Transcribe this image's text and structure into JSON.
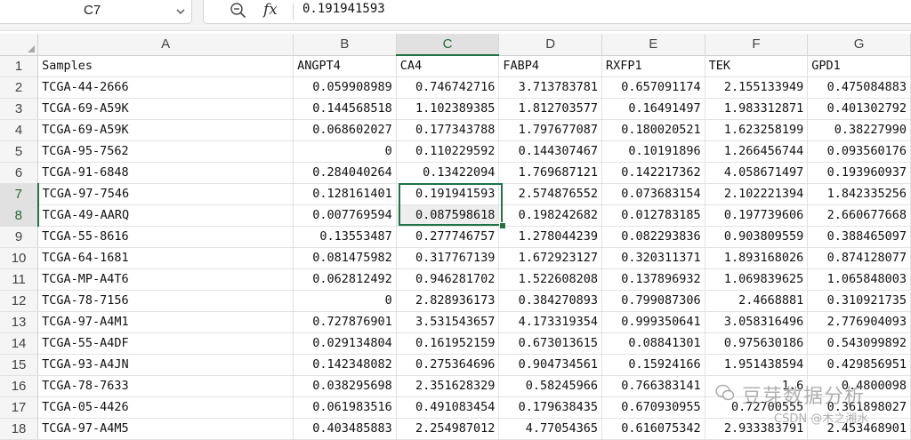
{
  "formula_bar": {
    "name_box": "C7",
    "fx_label": "fx",
    "formula_value": "0.191941593"
  },
  "columns": [
    "A",
    "B",
    "C",
    "D",
    "E",
    "F",
    "G"
  ],
  "active_column": "C",
  "active_rows": [
    7,
    8
  ],
  "rows": [
    {
      "num": "1",
      "cells": [
        "Samples",
        "ANGPT4",
        "CA4",
        "FABP4",
        "RXFP1",
        "TEK",
        "GPD1"
      ]
    },
    {
      "num": "2",
      "cells": [
        "TCGA-44-2666",
        "0.059908989",
        "0.746742716",
        "3.713783781",
        "0.657091174",
        "2.155133949",
        "0.475084883"
      ]
    },
    {
      "num": "3",
      "cells": [
        "TCGA-69-A59K",
        "0.144568518",
        "1.102389385",
        "1.812703577",
        "0.16491497",
        "1.983312871",
        "0.401302792"
      ]
    },
    {
      "num": "4",
      "cells": [
        "TCGA-69-A59K",
        "0.068602027",
        "0.177343788",
        "1.797677087",
        "0.180020521",
        "1.623258199",
        "0.38227990"
      ]
    },
    {
      "num": "5",
      "cells": [
        "TCGA-95-7562",
        "0",
        "0.110229592",
        "0.144307467",
        "0.10191896",
        "1.266456744",
        "0.093560176"
      ]
    },
    {
      "num": "6",
      "cells": [
        "TCGA-91-6848",
        "0.284040264",
        "0.13422094",
        "1.769687121",
        "0.142217362",
        "4.058671497",
        "0.193960937"
      ]
    },
    {
      "num": "7",
      "cells": [
        "TCGA-97-7546",
        "0.128161401",
        "0.191941593",
        "2.574876552",
        "0.073683154",
        "2.102221394",
        "1.842335256"
      ]
    },
    {
      "num": "8",
      "cells": [
        "TCGA-49-AARQ",
        "0.007769594",
        "0.087598618",
        "0.198242682",
        "0.012783185",
        "0.197739606",
        "2.660677668"
      ]
    },
    {
      "num": "9",
      "cells": [
        "TCGA-55-8616",
        "0.13553487",
        "0.277746757",
        "1.278044239",
        "0.082293836",
        "0.903809559",
        "0.388465097"
      ]
    },
    {
      "num": "10",
      "cells": [
        "TCGA-64-1681",
        "0.081475982",
        "0.317767139",
        "1.672923127",
        "0.320311371",
        "1.893168026",
        "0.874128077"
      ]
    },
    {
      "num": "11",
      "cells": [
        "TCGA-MP-A4T6",
        "0.062812492",
        "0.946281702",
        "1.522608208",
        "0.137896932",
        "1.069839625",
        "1.065848003"
      ]
    },
    {
      "num": "12",
      "cells": [
        "TCGA-78-7156",
        "0",
        "2.828936173",
        "0.384270893",
        "0.799087306",
        "2.4668881",
        "0.310921735"
      ]
    },
    {
      "num": "13",
      "cells": [
        "TCGA-97-A4M1",
        "0.727876901",
        "3.531543657",
        "4.173319354",
        "0.999350641",
        "3.058316496",
        "2.776904093"
      ]
    },
    {
      "num": "14",
      "cells": [
        "TCGA-55-A4DF",
        "0.029134804",
        "0.161952159",
        "0.673013615",
        "0.08841301",
        "0.975630186",
        "0.543099892"
      ]
    },
    {
      "num": "15",
      "cells": [
        "TCGA-93-A4JN",
        "0.142348082",
        "0.275364696",
        "0.904734561",
        "0.15924166",
        "1.951438594",
        "0.429856951"
      ]
    },
    {
      "num": "16",
      "cells": [
        "TCGA-78-7633",
        "0.038295698",
        "2.351628329",
        "0.58245966",
        "0.766383141",
        "1.6",
        "0.4800098"
      ]
    },
    {
      "num": "17",
      "cells": [
        "TCGA-05-4426",
        "0.061983516",
        "0.491083454",
        "0.179638435",
        "0.670930955",
        "0.72700555",
        "0.361898027"
      ]
    },
    {
      "num": "18",
      "cells": [
        "TCGA-97-A4M5",
        "0.403485883",
        "2.254987012",
        "4.77054365",
        "0.616075342",
        "2.933383791",
        "2.453468901"
      ]
    }
  ],
  "watermark": {
    "main": "豆芽数据分析",
    "sub": "CSDN @木之湘水"
  },
  "colors": {
    "selection": "#217346",
    "header_bg": "#f5f5f5",
    "gridline": "#e2e2e2"
  }
}
